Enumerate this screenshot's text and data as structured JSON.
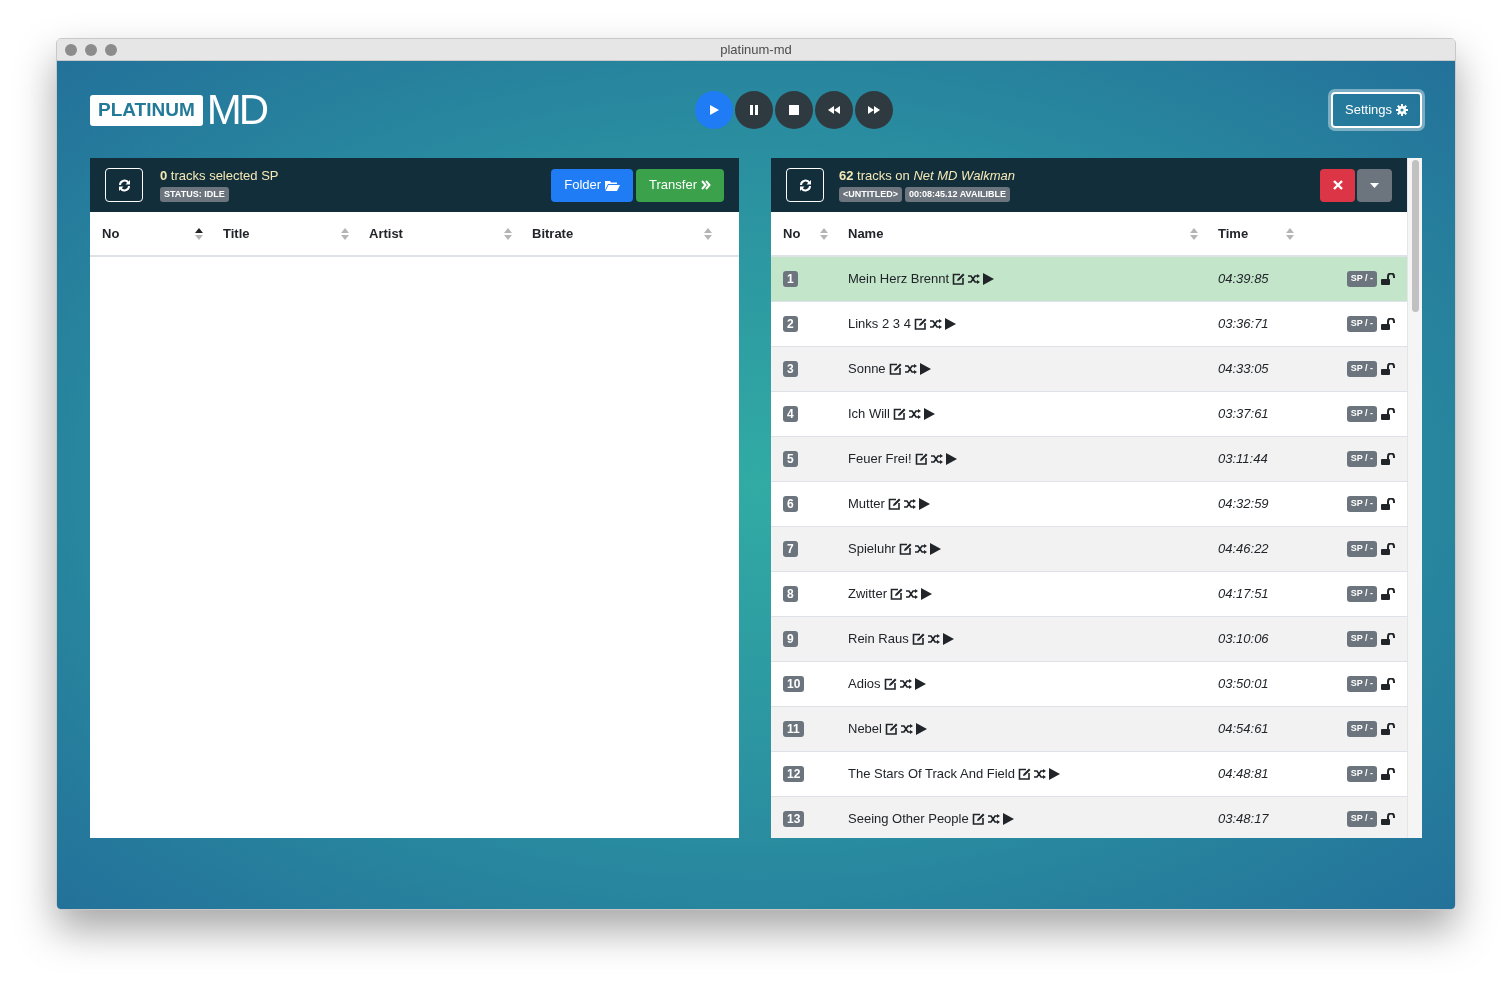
{
  "window": {
    "title": "platinum-md"
  },
  "logo": {
    "box_text": "PLATINUM",
    "big_text": "MD"
  },
  "player": [
    {
      "kind": "play",
      "active": true
    },
    {
      "kind": "pause",
      "active": false
    },
    {
      "kind": "stop",
      "active": false
    },
    {
      "kind": "rewind",
      "active": false
    },
    {
      "kind": "forward",
      "active": false
    }
  ],
  "settings_button": {
    "label": "Settings"
  },
  "local_panel": {
    "summary": "**0** tracks selected SP",
    "status": "STATUS: IDLE",
    "buttons": [
      {
        "kind": "folder",
        "label": "Folder"
      },
      {
        "kind": "transfer",
        "label": "Transfer"
      }
    ],
    "columns": [
      {
        "label": "No",
        "sorted": true
      },
      {
        "label": "Title",
        "sorted": false
      },
      {
        "label": "Artist",
        "sorted": false
      },
      {
        "label": "Bitrate",
        "sorted": false
      }
    ]
  },
  "device_panel": {
    "summary": "**62** tracks on *Net MD Walkman*",
    "badges": [
      "<UNTITLED>",
      "00:08:45.12 AVAILIBLE"
    ],
    "columns": [
      {
        "label": "No",
        "sorted": false
      },
      {
        "label": "Name",
        "sorted": false
      },
      {
        "label": "Time",
        "sorted": false
      }
    ],
    "rows": [
      {
        "no": "1",
        "name": "Mein Herz Brennt",
        "time": "04:39:85",
        "mode": "SP / -",
        "selected": true
      },
      {
        "no": "2",
        "name": "Links 2 3 4",
        "time": "03:36:71",
        "mode": "SP / -",
        "selected": false
      },
      {
        "no": "3",
        "name": "Sonne",
        "time": "04:33:05",
        "mode": "SP / -",
        "selected": false
      },
      {
        "no": "4",
        "name": "Ich Will",
        "time": "03:37:61",
        "mode": "SP / -",
        "selected": false
      },
      {
        "no": "5",
        "name": "Feuer Frei!",
        "time": "03:11:44",
        "mode": "SP / -",
        "selected": false
      },
      {
        "no": "6",
        "name": "Mutter",
        "time": "04:32:59",
        "mode": "SP / -",
        "selected": false
      },
      {
        "no": "7",
        "name": "Spieluhr",
        "time": "04:46:22",
        "mode": "SP / -",
        "selected": false
      },
      {
        "no": "8",
        "name": "Zwitter",
        "time": "04:17:51",
        "mode": "SP / -",
        "selected": false
      },
      {
        "no": "9",
        "name": "Rein Raus",
        "time": "03:10:06",
        "mode": "SP / -",
        "selected": false
      },
      {
        "no": "10",
        "name": "Adios",
        "time": "03:50:01",
        "mode": "SP / -",
        "selected": false
      },
      {
        "no": "11",
        "name": "Nebel",
        "time": "04:54:61",
        "mode": "SP / -",
        "selected": false
      },
      {
        "no": "12",
        "name": "The Stars Of Track And Field",
        "time": "04:48:81",
        "mode": "SP / -",
        "selected": false
      },
      {
        "no": "13",
        "name": "Seeing Other People",
        "time": "03:48:17",
        "mode": "SP / -",
        "selected": false
      }
    ]
  }
}
